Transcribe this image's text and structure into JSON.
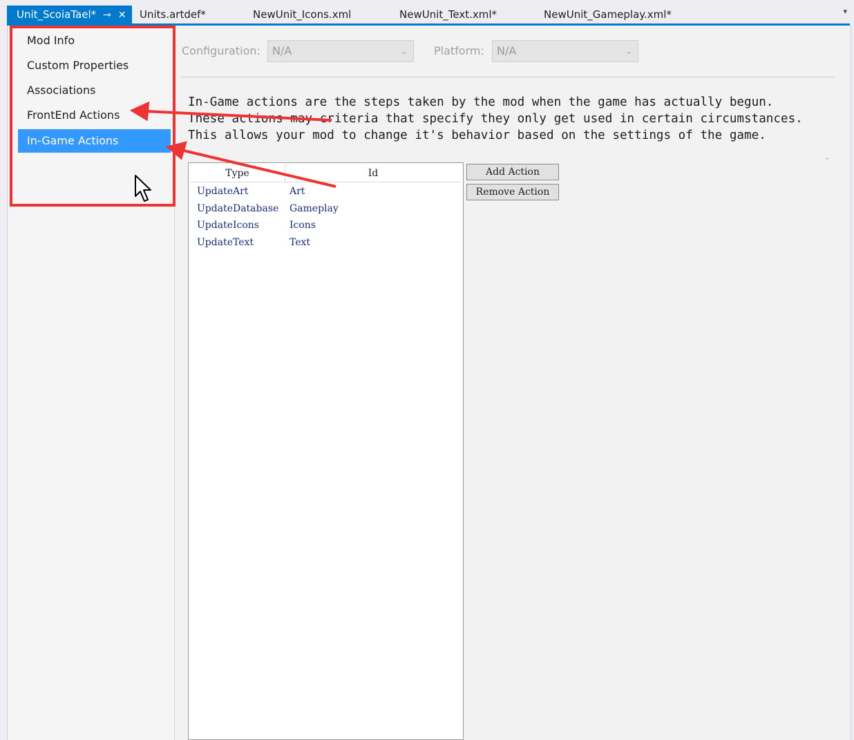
{
  "tabs": [
    {
      "label": "Unit_ScoiaTael*",
      "active": true
    },
    {
      "label": "Units.artdef*"
    },
    {
      "label": "NewUnit_Icons.xml"
    },
    {
      "label": "NewUnit_Text.xml*"
    },
    {
      "label": "NewUnit_Gameplay.xml*"
    }
  ],
  "tab_overflow": "▾",
  "pin_glyph": "⊸",
  "close_glyph": "✕",
  "sidebar": {
    "items": [
      {
        "label": "Mod Info"
      },
      {
        "label": "Custom Properties"
      },
      {
        "label": "Associations"
      },
      {
        "label": "FrontEnd Actions"
      },
      {
        "label": "In-Game Actions",
        "selected": true
      }
    ]
  },
  "config": {
    "configuration_label": "Configuration:",
    "configuration_value": "N/A",
    "platform_label": "Platform:",
    "platform_value": "N/A"
  },
  "description": {
    "line1": "In-Game actions are the steps taken by the mod when the game has actually begun.",
    "line2": "These actions may criteria that specify they only get used in certain circumstances.",
    "line3": "This allows your mod to change it's behavior based on the settings of the game."
  },
  "table": {
    "headers": {
      "type": "Type",
      "id": "Id"
    },
    "rows": [
      {
        "type": "UpdateArt",
        "id": "Art"
      },
      {
        "type": "UpdateDatabase",
        "id": "Gameplay"
      },
      {
        "type": "UpdateIcons",
        "id": "Icons"
      },
      {
        "type": "UpdateText",
        "id": "Text"
      }
    ]
  },
  "buttons": {
    "add": "Add Action",
    "remove": "Remove Action"
  },
  "colors": {
    "accent": "#007acc",
    "selection": "#3399ff",
    "annotation": "#ee3333"
  }
}
